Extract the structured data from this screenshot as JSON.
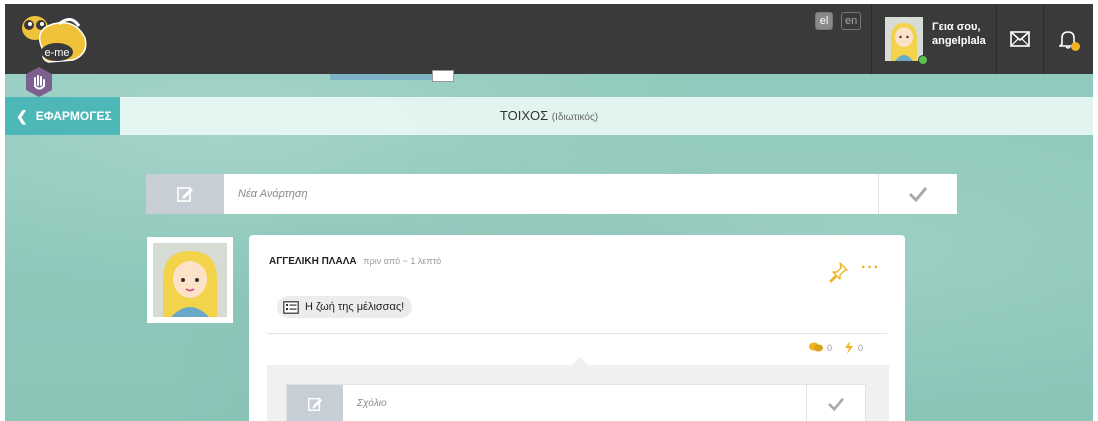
{
  "topbar": {
    "logo_text": "e-me",
    "lang_active": "el",
    "lang_inactive": "en",
    "greeting_line1": "Γεια σου,",
    "greeting_line2": "angelplala",
    "mail_icon": "mail-icon",
    "bell_icon": "bell-icon"
  },
  "header": {
    "back_label": "ΕΦΑΡΜΟΓΕΣ",
    "title": "ΤΟΙΧΟΣ",
    "title_sub": "(Ιδιωτικός)"
  },
  "new_post": {
    "placeholder": "Νέα Ανάρτηση"
  },
  "post": {
    "author": "ΑΓΓΕΛΙΚΗ ΠΛΑΛΑ",
    "time": "πριν από ~ 1 λεπτό",
    "tag_label": "Η ζωή της μέλισσας!",
    "comments_count": "0",
    "likes_count": "0",
    "comment_placeholder": "Σχόλιο"
  },
  "colors": {
    "topbar": "#3a3a3a",
    "accent_teal": "#4db8b7",
    "accent_yellow": "#f0b323",
    "background_mint": "#8fc9bd"
  }
}
